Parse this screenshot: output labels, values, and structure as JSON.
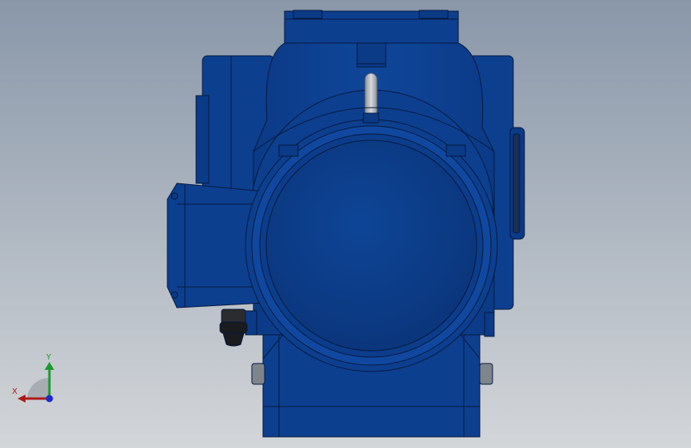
{
  "viewport": {
    "background_top": "#8a97a8",
    "background_bottom": "#d4d7da",
    "body_color": "#0d3f8f",
    "body_dark": "#082a66",
    "body_light": "#1a56b3",
    "edge_color": "#061a3d"
  },
  "triad": {
    "x_label": "X",
    "y_label": "Y",
    "x_color": "#b01818",
    "y_color": "#1a9a2a",
    "z_color": "#1a2ad0"
  }
}
